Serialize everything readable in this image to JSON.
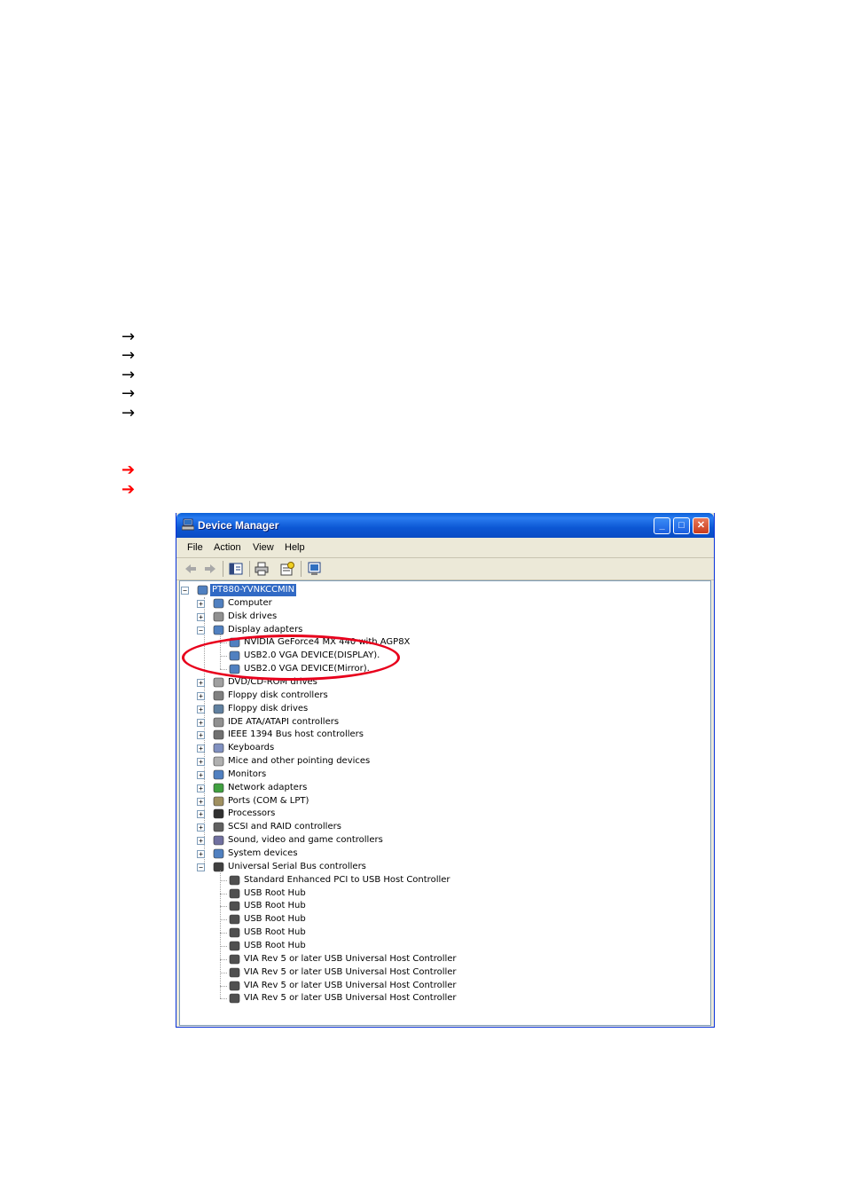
{
  "arrows": {
    "black_glyph": "→",
    "red_glyph": "➔",
    "black_count": 5,
    "red_count": 2
  },
  "window": {
    "title": "Device Manager",
    "buttons": {
      "minimize": "_",
      "maximize": "□",
      "close": "✕"
    },
    "menu": [
      "File",
      "Action",
      "View",
      "Help"
    ],
    "toolbar_icons": [
      "back-icon",
      "forward-icon",
      "show-hide-console-tree-icon",
      "print-icon",
      "properties-icon",
      "help-icon"
    ]
  },
  "tree": {
    "root": "PT880-YVNKCCMIN",
    "categories": [
      {
        "label": "Computer",
        "expanded": false
      },
      {
        "label": "Disk drives",
        "expanded": false
      },
      {
        "label": "Display adapters",
        "expanded": true,
        "children": [
          "NVIDIA GeForce4 MX 440 with AGP8X",
          "USB2.0 VGA DEVICE(DISPLAY).",
          "USB2.0 VGA DEVICE(Mirror)."
        ]
      },
      {
        "label": "DVD/CD-ROM drives",
        "expanded": false
      },
      {
        "label": "Floppy disk controllers",
        "expanded": false
      },
      {
        "label": "Floppy disk drives",
        "expanded": false
      },
      {
        "label": "IDE ATA/ATAPI controllers",
        "expanded": false
      },
      {
        "label": "IEEE 1394 Bus host controllers",
        "expanded": false
      },
      {
        "label": "Keyboards",
        "expanded": false
      },
      {
        "label": "Mice and other pointing devices",
        "expanded": false
      },
      {
        "label": "Monitors",
        "expanded": false
      },
      {
        "label": "Network adapters",
        "expanded": false
      },
      {
        "label": "Ports (COM & LPT)",
        "expanded": false
      },
      {
        "label": "Processors",
        "expanded": false
      },
      {
        "label": "SCSI and RAID controllers",
        "expanded": false
      },
      {
        "label": "Sound, video and game controllers",
        "expanded": false
      },
      {
        "label": "System devices",
        "expanded": false
      },
      {
        "label": "Universal Serial Bus controllers",
        "expanded": true,
        "children": [
          "Standard Enhanced PCI to USB Host Controller",
          "USB Root Hub",
          "USB Root Hub",
          "USB Root Hub",
          "USB Root Hub",
          "USB Root Hub",
          "VIA Rev 5 or later USB Universal Host Controller",
          "VIA Rev 5 or later USB Universal Host Controller",
          "VIA Rev 5 or later USB Universal Host Controller",
          "VIA Rev 5 or later USB Universal Host Controller"
        ]
      }
    ]
  },
  "colors": {
    "titlebar": "#0a5fd8",
    "highlight": "#316ac5",
    "annotation": "#e8001c",
    "red_arrow": "#ff0000"
  }
}
